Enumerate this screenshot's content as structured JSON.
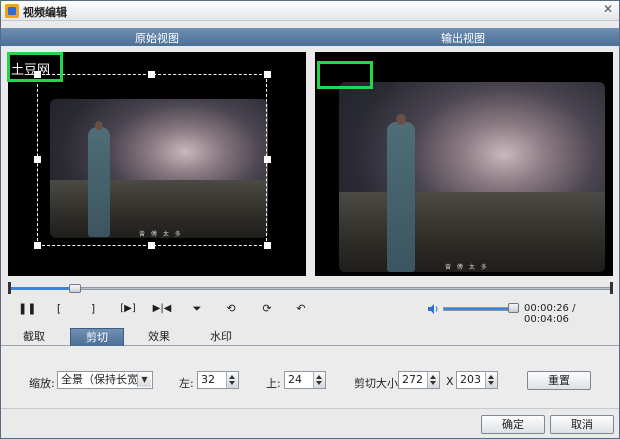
{
  "window": {
    "title": "视频编辑",
    "close_glyph": "✕"
  },
  "views": {
    "original_title": "原始视图",
    "output_title": "输出视图"
  },
  "preview": {
    "watermark_text": "土豆网",
    "caption_text": "曾 傅 太 多"
  },
  "playback": {
    "progress_fraction": 0.11,
    "volume_fraction": 0.9,
    "time_readout": "00:00:26 / 00:04:06",
    "controls": [
      {
        "name": "pause-icon",
        "glyph": "❚❚"
      },
      {
        "name": "mark-in-icon",
        "glyph": "["
      },
      {
        "name": "mark-out-icon",
        "glyph": "]"
      },
      {
        "name": "play-segment-icon",
        "glyph": "[▶]"
      },
      {
        "name": "split-icon",
        "glyph": "▶|◀"
      },
      {
        "name": "flip-vertical-icon",
        "glyph": "⏷"
      },
      {
        "name": "rotate-left-icon",
        "glyph": "⟲"
      },
      {
        "name": "rotate-right-icon",
        "glyph": "⟳"
      },
      {
        "name": "undo-icon",
        "glyph": "↶"
      }
    ]
  },
  "tabs": [
    {
      "label": "截取",
      "active": false
    },
    {
      "label": "剪切",
      "active": true
    },
    {
      "label": "效果",
      "active": false
    },
    {
      "label": "水印",
      "active": false
    }
  ],
  "crop": {
    "zoom_label": "缩放:",
    "zoom_value": "全景（保持长宽）",
    "left_label": "左:",
    "left_value": "32",
    "top_label": "上:",
    "top_value": "24",
    "size_label": "剪切大小:",
    "width_value": "272",
    "times_sign": "X",
    "height_value": "203",
    "reset_label": "重置"
  },
  "footer": {
    "ok_label": "确定",
    "cancel_label": "取消"
  },
  "colors": {
    "accent": "#4c6f96",
    "highlight_box": "#22d74c",
    "progress": "#3a86d9"
  }
}
